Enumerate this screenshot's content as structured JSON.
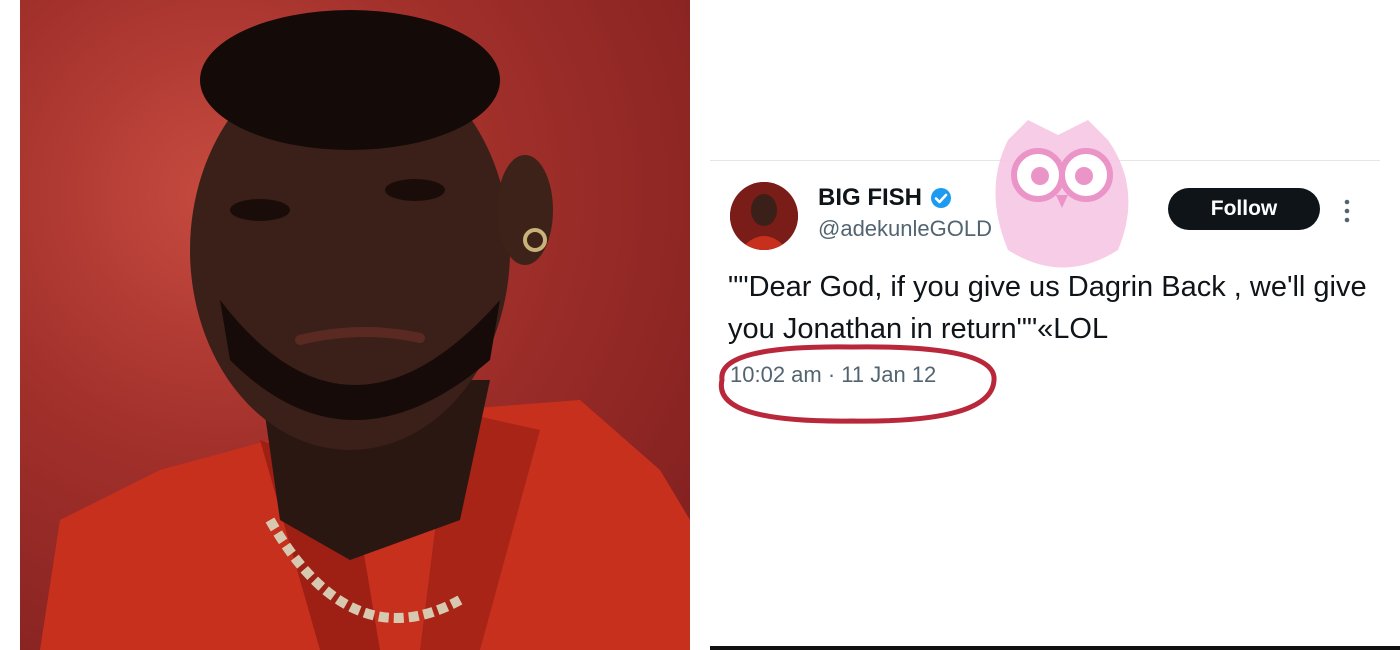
{
  "tweet": {
    "display_name": "BIG FISH",
    "handle": "@adekunleGOLD",
    "follow_label": "Follow",
    "text": "\"\"Dear God, if you give us Dagrin Back , we'll give you Jonathan in return\"\"«LOL",
    "timestamp": "10:02 am · 11 Jan 12",
    "verified": true
  },
  "icons": {
    "verified": "verified-badge-icon",
    "more": "more-vertical-icon"
  },
  "colors": {
    "photo_background": "#a2302b",
    "jacket": "#c8301e",
    "follow_button": "#0f1419",
    "verified_badge": "#1d9bf0",
    "highlight_circle": "#b8283a",
    "watermark": "#f4a9d4"
  }
}
